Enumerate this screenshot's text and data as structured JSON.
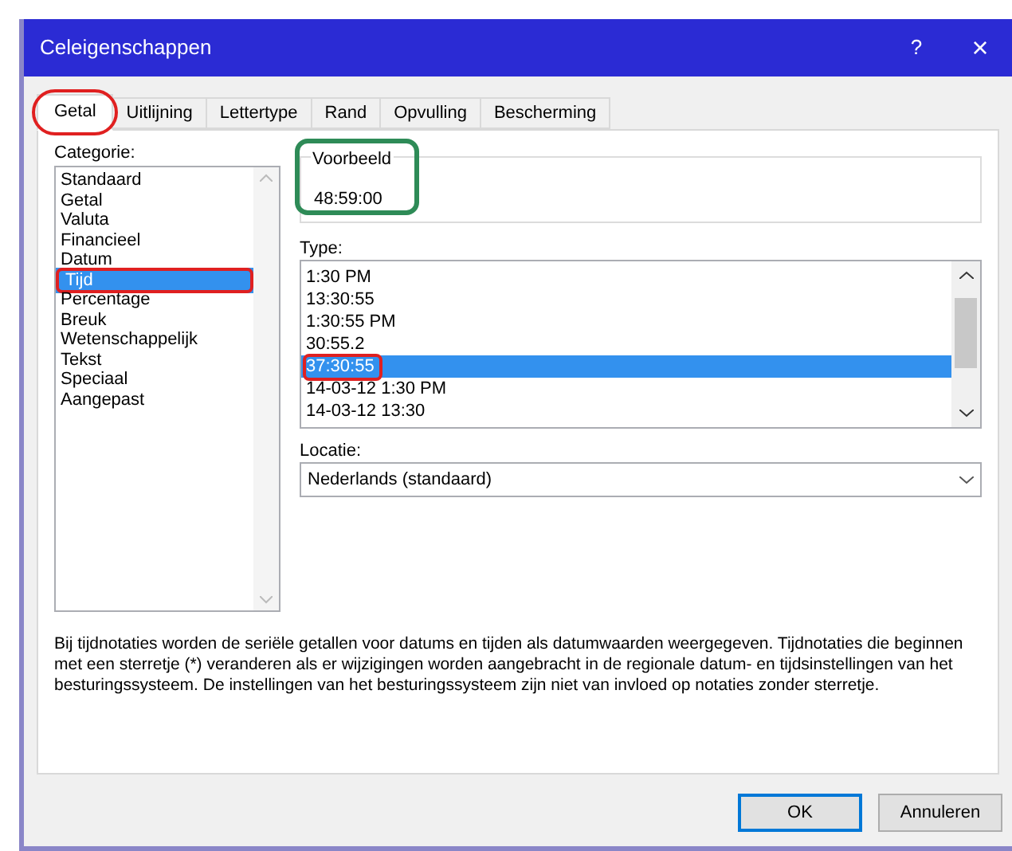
{
  "window": {
    "title": "Celeigenschappen",
    "help": "?",
    "close": "×"
  },
  "tabs": [
    {
      "label": "Getal",
      "selected": true,
      "circled": true
    },
    {
      "label": "Uitlijning",
      "selected": false,
      "circled": false
    },
    {
      "label": "Lettertype",
      "selected": false,
      "circled": false
    },
    {
      "label": "Rand",
      "selected": false,
      "circled": false
    },
    {
      "label": "Opvulling",
      "selected": false,
      "circled": false
    },
    {
      "label": "Bescherming",
      "selected": false,
      "circled": false
    }
  ],
  "category": {
    "label": "Categorie:",
    "items": [
      {
        "label": "Standaard",
        "selected": false,
        "circled": false
      },
      {
        "label": "Getal",
        "selected": false,
        "circled": false
      },
      {
        "label": "Valuta",
        "selected": false,
        "circled": false
      },
      {
        "label": "Financieel",
        "selected": false,
        "circled": false
      },
      {
        "label": "Datum",
        "selected": false,
        "circled": false
      },
      {
        "label": "Tijd",
        "selected": true,
        "circled": true
      },
      {
        "label": "Percentage",
        "selected": false,
        "circled": false
      },
      {
        "label": "Breuk",
        "selected": false,
        "circled": false
      },
      {
        "label": "Wetenschappelijk",
        "selected": false,
        "circled": false
      },
      {
        "label": "Tekst",
        "selected": false,
        "circled": false
      },
      {
        "label": "Speciaal",
        "selected": false,
        "circled": false
      },
      {
        "label": "Aangepast",
        "selected": false,
        "circled": false
      }
    ]
  },
  "preview": {
    "label": "Voorbeeld",
    "value": "48:59:00",
    "circled": true
  },
  "type": {
    "label": "Type:",
    "items": [
      {
        "label": "1:30 PM",
        "selected": false,
        "circled": false
      },
      {
        "label": "13:30:55",
        "selected": false,
        "circled": false
      },
      {
        "label": "1:30:55 PM",
        "selected": false,
        "circled": false
      },
      {
        "label": "30:55.2",
        "selected": false,
        "circled": false
      },
      {
        "label": "37:30:55",
        "selected": true,
        "circled": true
      },
      {
        "label": "14-03-12 1:30 PM",
        "selected": false,
        "circled": false
      },
      {
        "label": "14-03-12 13:30",
        "selected": false,
        "circled": false
      }
    ]
  },
  "location": {
    "label": "Locatie:",
    "value": "Nederlands (standaard)"
  },
  "description": "Bij tijdnotaties worden de seriële getallen voor datums en tijden als datumwaarden weergegeven. Tijdnotaties die beginnen met een sterretje (*) veranderen als er wijzigingen worden aangebracht in de regionale datum- en tijdsinstellingen van het besturingssysteem. De instellingen van het besturingssysteem zijn niet van invloed op notaties zonder sterretje.",
  "buttons": [
    {
      "label": "OK",
      "default": true
    },
    {
      "label": "Annuleren",
      "default": false
    }
  ]
}
